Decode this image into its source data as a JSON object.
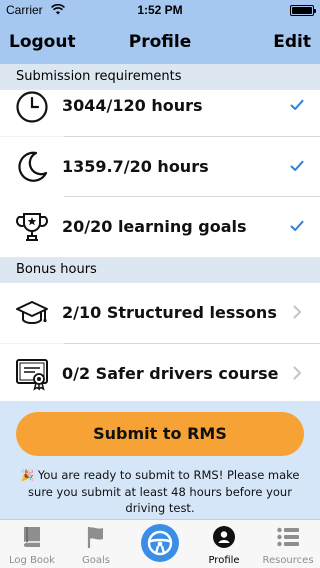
{
  "status_bar": {
    "carrier": "Carrier",
    "time": "1:52 PM"
  },
  "nav": {
    "left_label": "Logout",
    "title": "Profile",
    "right_label": "Edit"
  },
  "sections": {
    "requirements_title": "Submission requirements",
    "bonus_title": "Bonus hours"
  },
  "requirements": [
    {
      "label": "3044/120 hours",
      "icon": "clock-icon",
      "status": "checkmark"
    },
    {
      "label": "1359.7/20 hours",
      "icon": "moon-icon",
      "status": "checkmark"
    },
    {
      "label": "20/20 learning goals",
      "icon": "trophy-icon",
      "status": "checkmark"
    }
  ],
  "bonus": [
    {
      "label": "2/10 Structured lessons",
      "icon": "graduation-cap-icon"
    },
    {
      "label": "0/2 Safer drivers course",
      "icon": "certificate-icon"
    }
  ],
  "footer": {
    "submit_label": "Submit to RMS",
    "notice_emoji": "🎉",
    "notice_text": "You are ready to submit to RMS! Please make sure you submit at least 48 hours before your driving test."
  },
  "tabs": [
    {
      "label": "Log Book",
      "icon": "book-icon",
      "active": false
    },
    {
      "label": "Goals",
      "icon": "flag-icon",
      "active": false
    },
    {
      "label": "",
      "icon": "steering-wheel-icon",
      "active": false
    },
    {
      "label": "Profile",
      "icon": "person-icon",
      "active": true
    },
    {
      "label": "Resources",
      "icon": "list-icon",
      "active": false
    }
  ],
  "colors": {
    "nav_background": "#a6c8f0",
    "section_header": "#dde7f2",
    "accent_check": "#2f7fe0",
    "submit_button": "#f7a234",
    "footer_background": "#d5e6f8"
  }
}
